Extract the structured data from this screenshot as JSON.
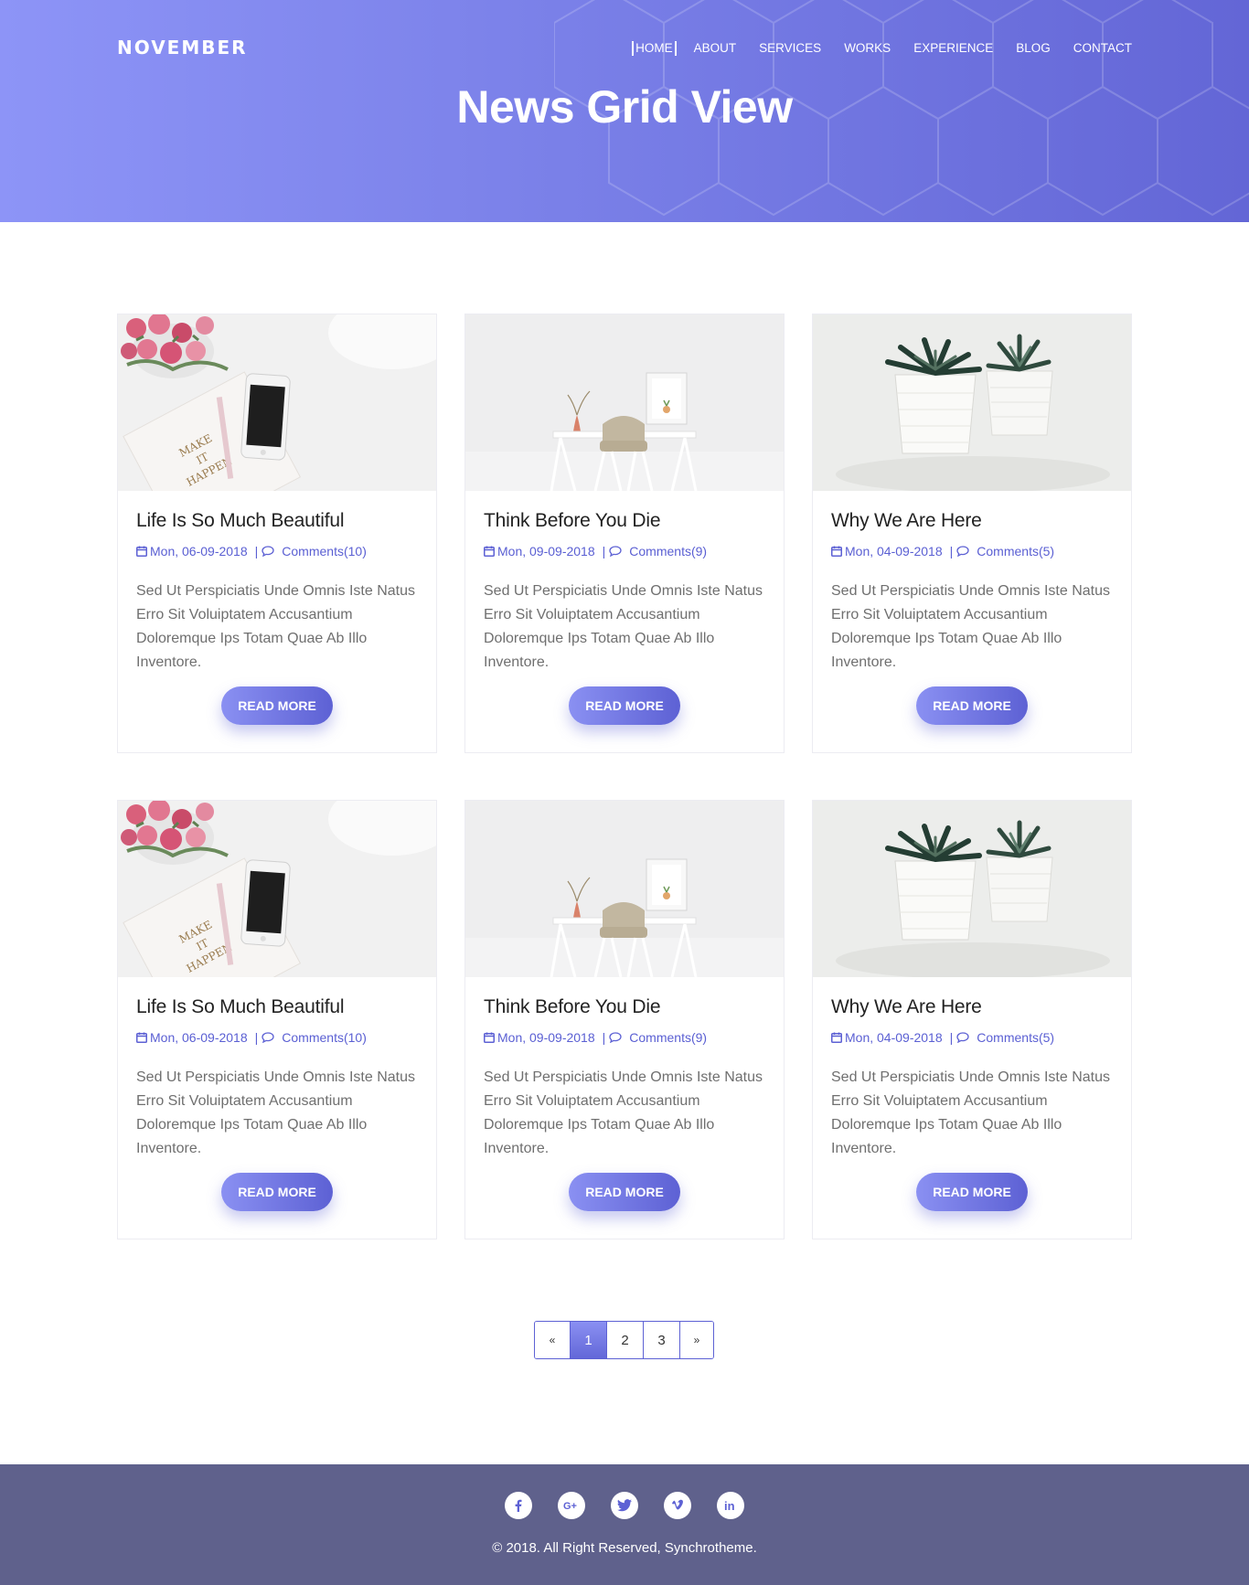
{
  "header": {
    "logo": "NOVEMBER",
    "nav": [
      {
        "label": "HOME",
        "active": true
      },
      {
        "label": "ABOUT",
        "active": false
      },
      {
        "label": "SERVICES",
        "active": false
      },
      {
        "label": "WORKS",
        "active": false
      },
      {
        "label": "EXPERIENCE",
        "active": false
      },
      {
        "label": "BLOG",
        "active": false
      },
      {
        "label": "CONTACT",
        "active": false
      }
    ],
    "title": "News Grid View"
  },
  "posts": [
    {
      "title": "Life Is So Much Beautiful",
      "date": "Mon, 06-09-2018",
      "comments": "Comments(10)",
      "excerpt": "Sed Ut Perspiciatis Unde Omnis Iste Natus Erro Sit Voluiptatem Accusantium Doloremque Ips Totam Quae Ab Illo Inventore.",
      "button": "READ MORE",
      "image": "flowers-phone-notebook"
    },
    {
      "title": "Think Before You Die",
      "date": "Mon, 09-09-2018",
      "comments": "Comments(9)",
      "excerpt": "Sed Ut Perspiciatis Unde Omnis Iste Natus Erro Sit Voluiptatem Accusantium Doloremque Ips Totam Quae Ab Illo Inventore.",
      "button": "READ MORE",
      "image": "desk-chair"
    },
    {
      "title": "Why We Are Here",
      "date": "Mon, 04-09-2018",
      "comments": "Comments(5)",
      "excerpt": "Sed Ut Perspiciatis Unde Omnis Iste Natus Erro Sit Voluiptatem Accusantium Doloremque Ips Totam Quae Ab Illo Inventore.",
      "button": "READ MORE",
      "image": "succulent-pots"
    },
    {
      "title": "Life Is So Much Beautiful",
      "date": "Mon, 06-09-2018",
      "comments": "Comments(10)",
      "excerpt": "Sed Ut Perspiciatis Unde Omnis Iste Natus Erro Sit Voluiptatem Accusantium Doloremque Ips Totam Quae Ab Illo Inventore.",
      "button": "READ MORE",
      "image": "flowers-phone-notebook"
    },
    {
      "title": "Think Before You Die",
      "date": "Mon, 09-09-2018",
      "comments": "Comments(9)",
      "excerpt": "Sed Ut Perspiciatis Unde Omnis Iste Natus Erro Sit Voluiptatem Accusantium Doloremque Ips Totam Quae Ab Illo Inventore.",
      "button": "READ MORE",
      "image": "desk-chair"
    },
    {
      "title": "Why We Are Here",
      "date": "Mon, 04-09-2018",
      "comments": "Comments(5)",
      "excerpt": "Sed Ut Perspiciatis Unde Omnis Iste Natus Erro Sit Voluiptatem Accusantium Doloremque Ips Totam Quae Ab Illo Inventore.",
      "button": "READ MORE",
      "image": "succulent-pots"
    }
  ],
  "notebook_text": "MAKE IT HAPPEN",
  "pagination": {
    "prev": "«",
    "pages": [
      "1",
      "2",
      "3"
    ],
    "current": "1",
    "next": "»"
  },
  "footer": {
    "socials": [
      "facebook-icon",
      "google-plus-icon",
      "twitter-icon",
      "vimeo-icon",
      "linkedin-icon"
    ],
    "copyright": "© 2018. All Right Reserved, Synchrotheme."
  },
  "colors": {
    "accent": "#5d61d4",
    "hero_start": "#8d94f7",
    "hero_end": "#6366d6",
    "footer": "#5f618c"
  }
}
